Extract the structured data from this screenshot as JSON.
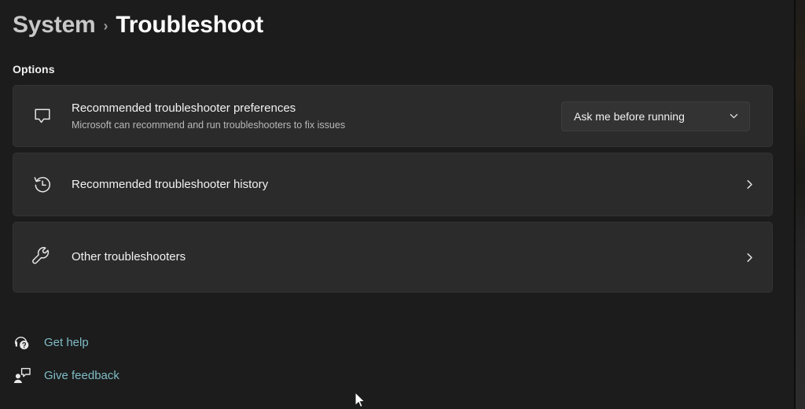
{
  "header": {
    "breadcrumb_parent": "System",
    "breadcrumb_separator": "›",
    "breadcrumb_current": "Troubleshoot"
  },
  "section": {
    "label": "Options"
  },
  "cards": [
    {
      "icon": "speech-bubble-icon",
      "title": "Recommended troubleshooter preferences",
      "subtitle": "Microsoft can recommend and run troubleshooters to fix issues",
      "control": "dropdown",
      "dropdown_value": "Ask me before running",
      "dropdown_icon": "chevron-down-icon"
    },
    {
      "icon": "history-clock-icon",
      "title": "Recommended troubleshooter history",
      "subtitle": "",
      "control": "chevron",
      "chevron_icon": "chevron-right-icon"
    },
    {
      "icon": "wrench-icon",
      "title": "Other troubleshooters",
      "subtitle": "",
      "control": "chevron",
      "chevron_icon": "chevron-right-icon"
    }
  ],
  "footer_links": [
    {
      "icon": "get-help-icon",
      "label": "Get help"
    },
    {
      "icon": "give-feedback-icon",
      "label": "Give feedback"
    }
  ],
  "colors": {
    "page_background": "#1c1c1c",
    "card_background": "#2b2b2b",
    "dropdown_background": "#333333",
    "accent_link": "#7fbcc6",
    "primary_text": "#f2f2f2",
    "secondary_text": "#b9b9b9"
  }
}
